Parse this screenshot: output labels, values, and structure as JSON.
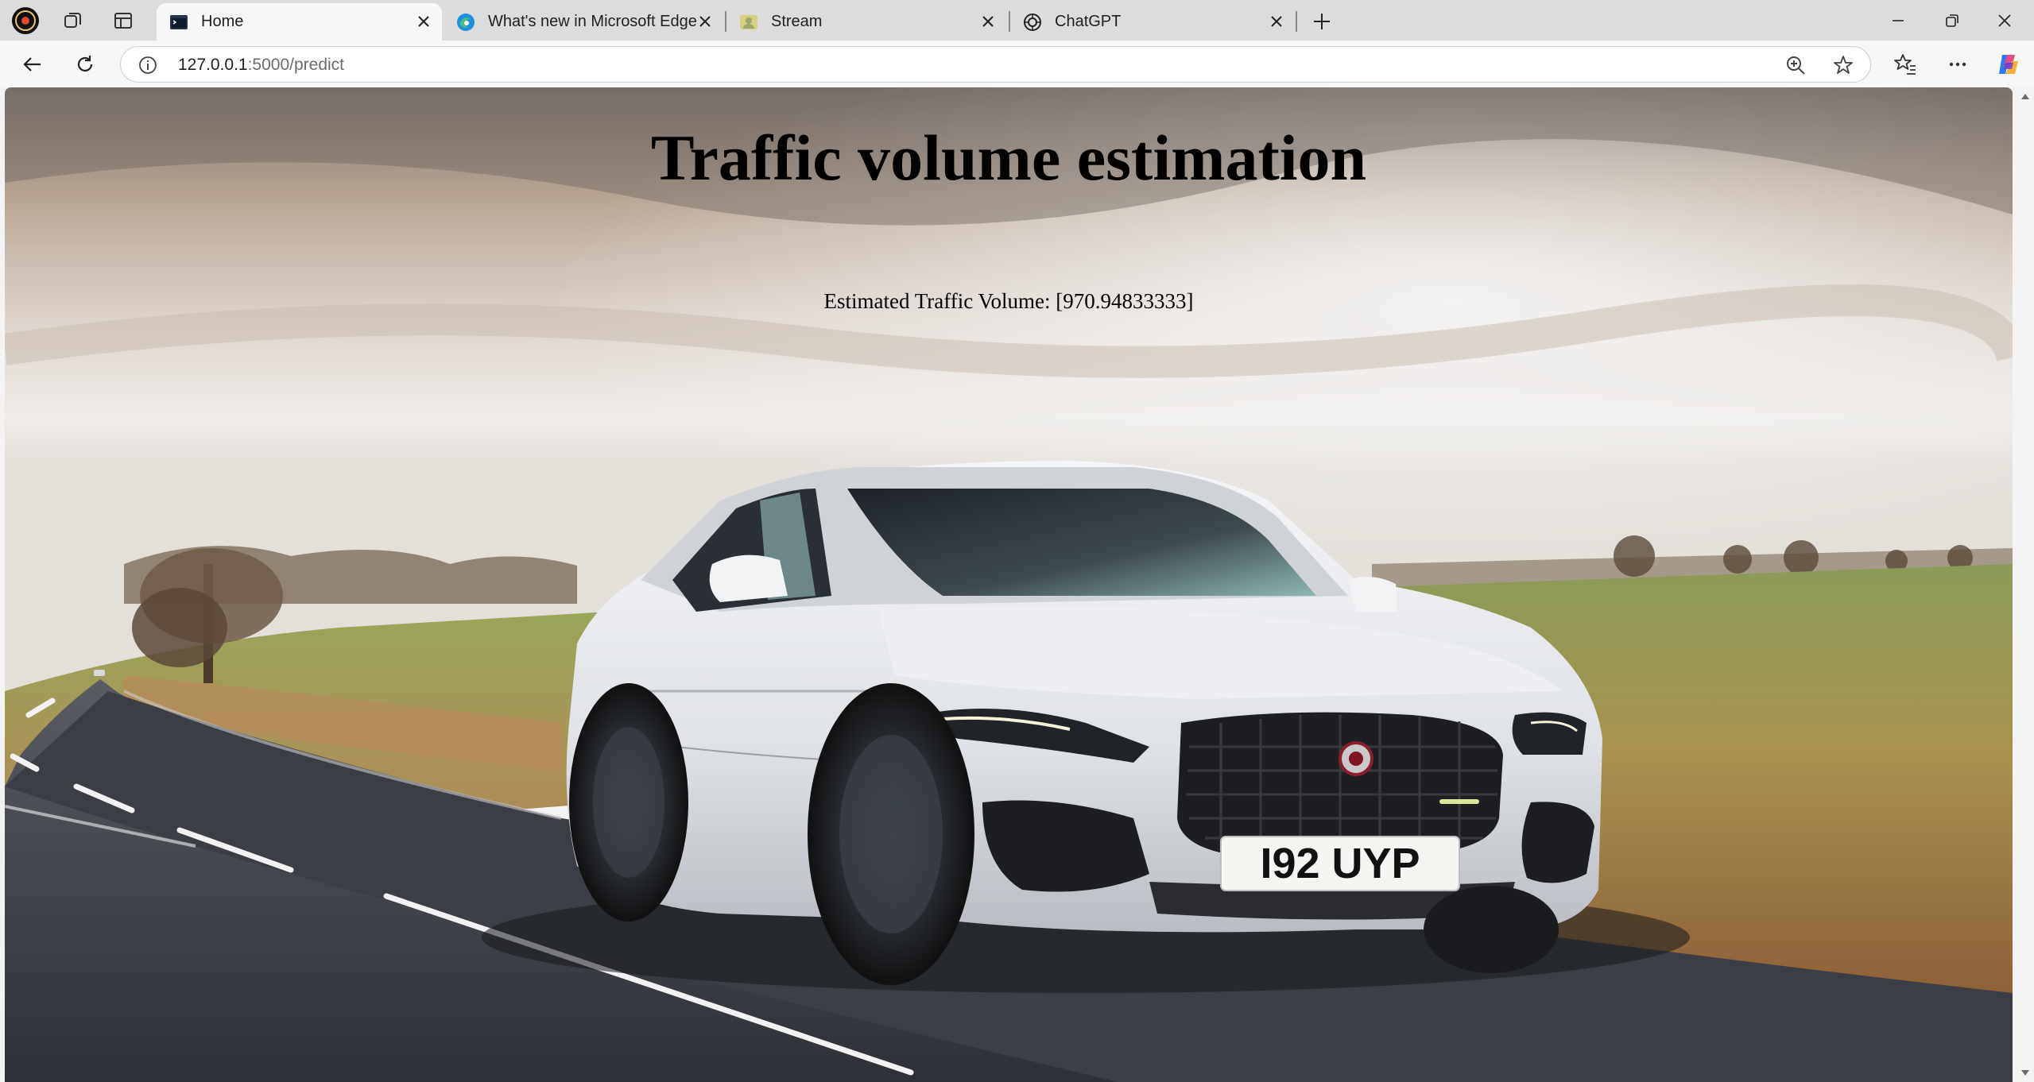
{
  "browser": {
    "tabs": [
      {
        "title": "Home",
        "active": true
      },
      {
        "title": "What's new in Microsoft Edge",
        "active": false
      },
      {
        "title": "Stream",
        "active": false
      },
      {
        "title": "ChatGPT",
        "active": false
      }
    ],
    "address": {
      "host": "127.0.0.1",
      "path": ":5000/predict"
    }
  },
  "page": {
    "title": "Traffic volume estimation",
    "result": "Estimated Traffic Volume: [970.94833333]",
    "license_plate": "I92 UYP"
  },
  "colors": {
    "tabstrip": "#dcdcdc",
    "toolbar": "#f7f7f7",
    "car_body": "#e9ebee",
    "sky": "#c9b7a4",
    "road": "#3a3d44",
    "grass": "#8c9b52"
  }
}
